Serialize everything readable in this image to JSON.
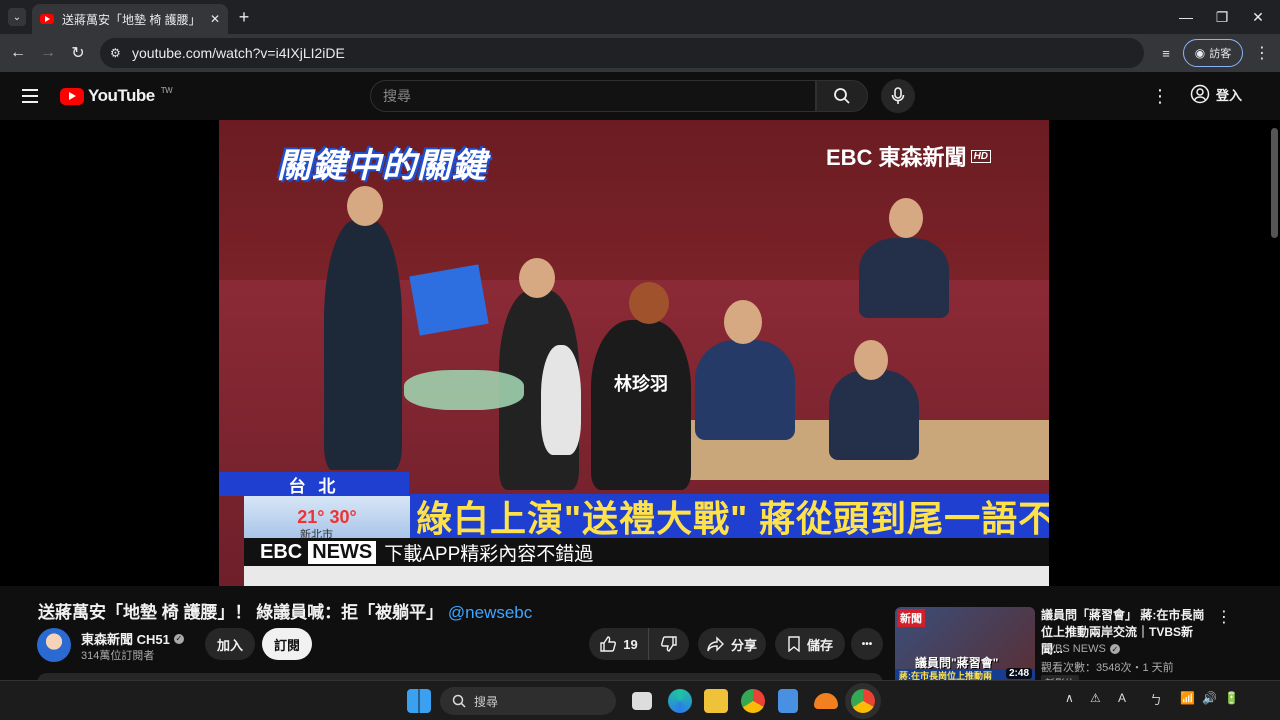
{
  "browser": {
    "tab_title": "送蔣萬安「地墊 椅 護腰」！綠",
    "url": "youtube.com/watch?v=i4IXjLI2iDE",
    "guest_label": "訪客",
    "win_controls": [
      "—",
      "❐",
      "✕"
    ]
  },
  "youtube": {
    "logo_text": "YouTube",
    "region": "TW",
    "search_placeholder": "搜尋",
    "signin_label": "登入"
  },
  "video_frame": {
    "show_badge": "關鍵中的關鍵",
    "channel_logo": "EBC 東森新聞",
    "hd": "HD",
    "city": "台 北",
    "weather": "21° 30°",
    "weather_city": "新北市",
    "headline": "綠白上演\"送禮大戰\" 蔣從頭到尾一語不發",
    "ticker_brand": "EBC",
    "ticker_news": "NEWS",
    "ticker_message": "下載APP精彩內容不錯過"
  },
  "video": {
    "title": "送蔣萬安「地墊 椅 護腰」！ 綠議員喊：拒「被躺平」",
    "handle": "@newsebc",
    "channel_name": "東森新聞 CH51",
    "subscribers": "314萬位訂閱者",
    "join_label": "加入",
    "subscribe_label": "訂閱",
    "likes": "19",
    "share_label": "分享",
    "save_label": "儲存",
    "more_label": "•••"
  },
  "related": [
    {
      "title": "議員問「蔣習會」 蔣:在市長崗位上推動兩岸交流｜TVBS新聞...",
      "channel": "TVBS NEWS",
      "meta": "觀看次數：3548次・1 天前",
      "badge": "新影片",
      "duration": "2:48",
      "thumb_caption": "議員問\"蔣習會\"",
      "thumb_subcaption": "蔣:在市長崗位上推動兩",
      "thumb_tag": "新聞"
    }
  ],
  "taskbar": {
    "search_label": "搜尋",
    "tray": [
      "∧",
      "⚠",
      "A",
      "ㄅ",
      "📶",
      "🔊",
      "🔋"
    ]
  },
  "colors": {
    "youtube_red": "#ff0000",
    "link_blue": "#3ea6ff",
    "headline_yellow": "#ffe14a",
    "headline_blue": "#1f3fd0"
  }
}
